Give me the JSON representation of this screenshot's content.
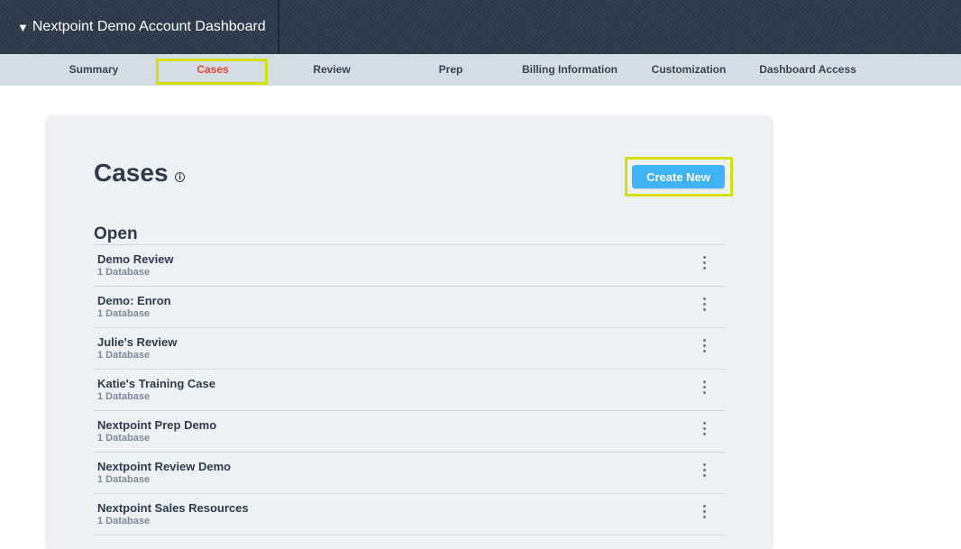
{
  "header": {
    "caret": "▼",
    "account_title": "Nextpoint Demo Account Dashboard"
  },
  "tabs": [
    {
      "label": "Summary",
      "active": false
    },
    {
      "label": "Cases",
      "active": true
    },
    {
      "label": "Review",
      "active": false
    },
    {
      "label": "Prep",
      "active": false
    },
    {
      "label": "Billing Information",
      "active": false
    },
    {
      "label": "Customization",
      "active": false
    },
    {
      "label": "Dashboard Access",
      "active": false
    }
  ],
  "main": {
    "title": "Cases",
    "info_glyph": "i",
    "create_label": "Create New",
    "section_heading": "Open",
    "cases": [
      {
        "name": "Demo Review",
        "databases": "1 Database"
      },
      {
        "name": "Demo: Enron",
        "databases": "1 Database"
      },
      {
        "name": "Julie's Review",
        "databases": "1 Database"
      },
      {
        "name": "Katie's Training Case",
        "databases": "1 Database"
      },
      {
        "name": "Nextpoint Prep Demo",
        "databases": "1 Database"
      },
      {
        "name": "Nextpoint Review Demo",
        "databases": "1 Database"
      },
      {
        "name": "Nextpoint Sales Resources",
        "databases": "1 Database"
      }
    ]
  },
  "colors": {
    "header_bg": "#2e3a4c",
    "tabnav_bg": "#d5dde4",
    "active_tab": "#e8452c",
    "highlight": "#d4e100",
    "primary_button": "#3fb3f4",
    "panel_bg": "#edf1f4"
  },
  "icons": {
    "caret": "caret-down-icon",
    "info": "info-icon",
    "row_menu": "kebab-menu-icon"
  }
}
